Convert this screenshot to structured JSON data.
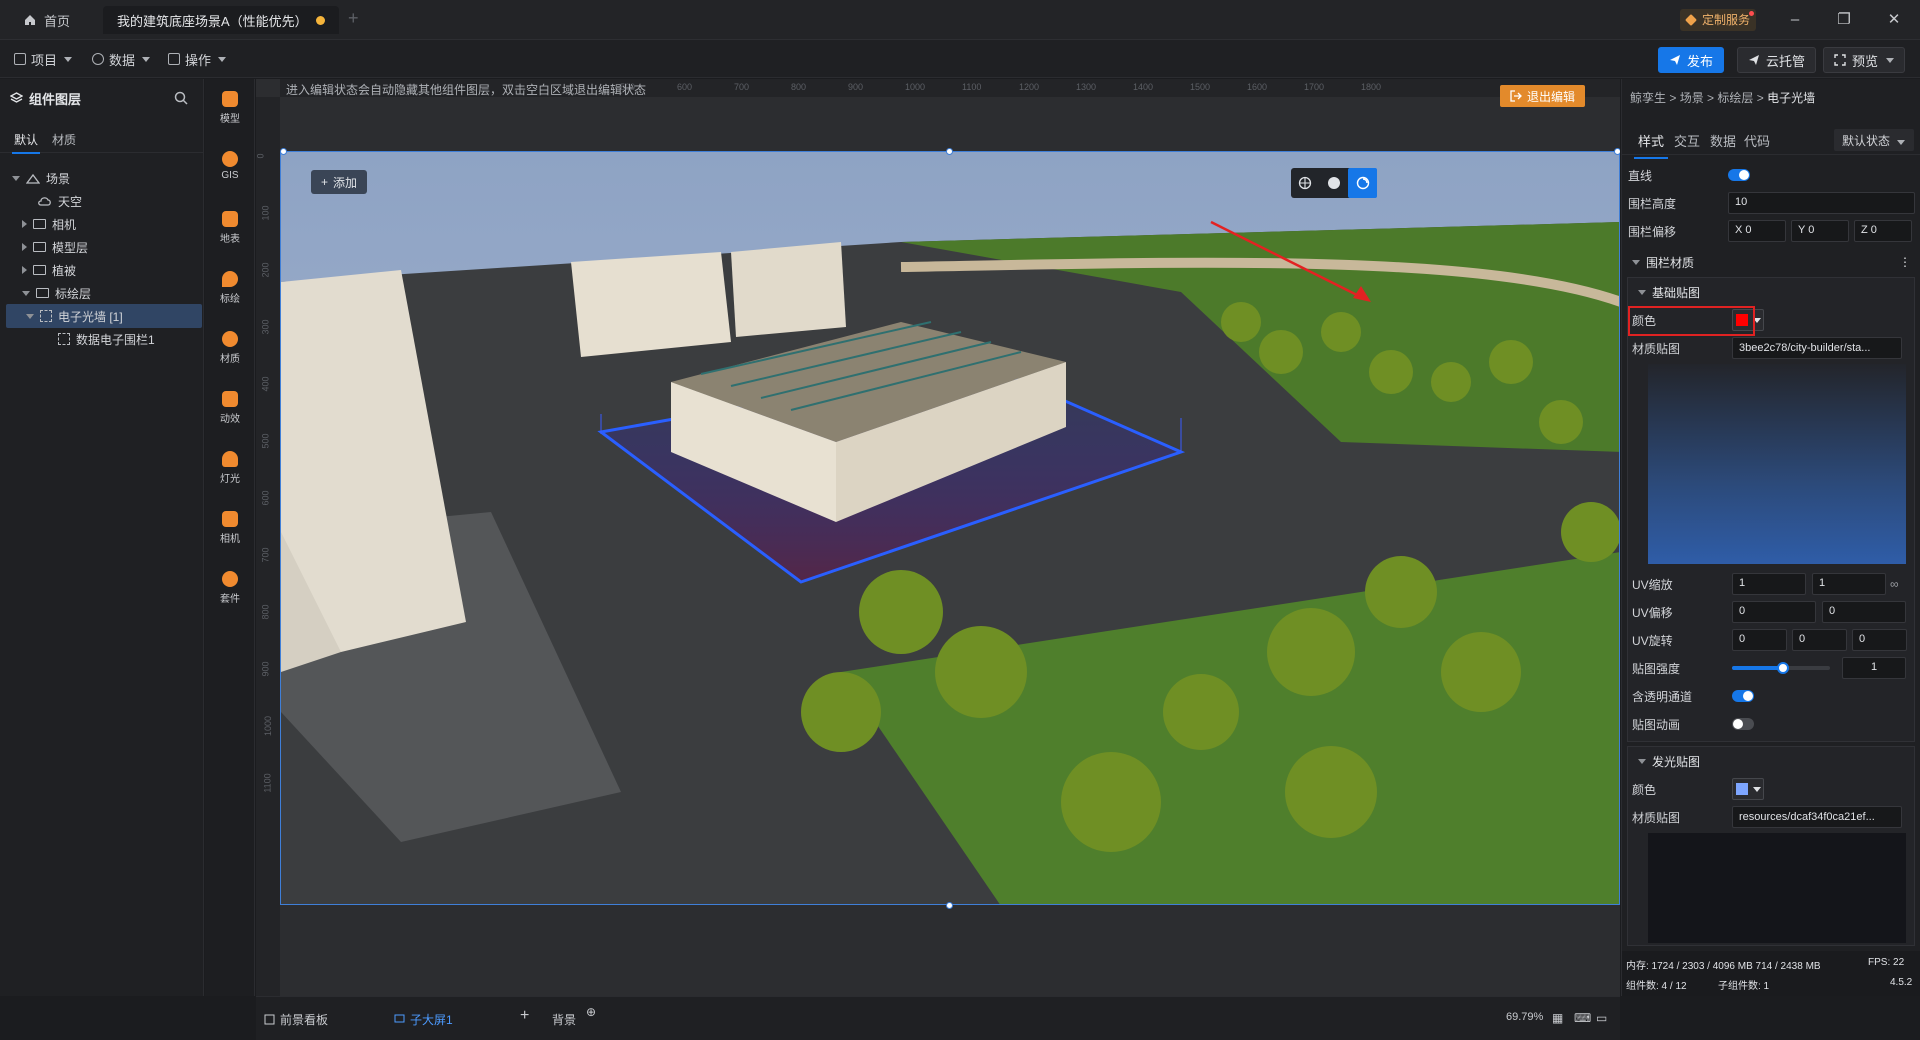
{
  "titlebar": {
    "home_tab": "首页",
    "doc_tab": "我的建筑底座场景A（性能优先）",
    "custom_service": "定制服务"
  },
  "toolbar": {
    "menus": [
      "项目",
      "数据",
      "操作"
    ],
    "publish": "发布",
    "cloud": "云托管",
    "preview": "预览"
  },
  "layers": {
    "title": "组件图层",
    "tabs": [
      "默认",
      "材质"
    ],
    "tree": [
      {
        "label": "场景"
      },
      {
        "label": "天空"
      },
      {
        "label": "相机"
      },
      {
        "label": "模型层"
      },
      {
        "label": "植被"
      },
      {
        "label": "标绘层"
      },
      {
        "label": "电子光墙 [1]"
      },
      {
        "label": "数据电子围栏1"
      }
    ]
  },
  "rail": [
    "模型",
    "GIS",
    "地表",
    "标绘",
    "材质",
    "动效",
    "灯光",
    "相机",
    "套件"
  ],
  "canvas": {
    "hint": "进入编辑状态会自动隐藏其他组件图层，双击空白区域退出编辑状态",
    "exit_edit": "退出编辑",
    "add": "添加",
    "ruler_top": [
      "500",
      "600",
      "700",
      "800",
      "900",
      "1000",
      "1100",
      "1200",
      "1300",
      "1400",
      "1500",
      "1600",
      "1700",
      "1800"
    ],
    "ruler_left": [
      "0",
      "100",
      "200",
      "300",
      "400",
      "500",
      "600",
      "700",
      "800",
      "900",
      "1000",
      "1100"
    ]
  },
  "bottombar": {
    "tabs": [
      "前景看板",
      "子大屏1",
      "背景"
    ],
    "zoom": "69.79%"
  },
  "props": {
    "breadcrumb": [
      "鲸孪生",
      "场景",
      "标绘层",
      "电子光墙"
    ],
    "tabs": [
      "样式",
      "交互",
      "数据",
      "代码"
    ],
    "state": "默认状态",
    "straight_label": "直线",
    "fence_height_label": "围栏高度",
    "fence_height": "10",
    "fence_offset_label": "围栏偏移",
    "offset": {
      "x": "0",
      "y": "0",
      "z": "0"
    },
    "material_section": "围栏材质",
    "base_map": {
      "title": "基础贴图",
      "color_label": "颜色",
      "color": "#ff0000",
      "texture_label": "材质贴图",
      "texture": "3bee2c78/city-builder/sta...",
      "uv_scale_label": "UV缩放",
      "uv_scale": [
        "1",
        "1"
      ],
      "uv_offset_label": "UV偏移",
      "uv_offset": [
        "0",
        "0"
      ],
      "uv_rotate_label": "UV旋转",
      "uv_rotate": [
        "0",
        "0",
        "0"
      ],
      "intensity_label": "贴图强度",
      "intensity": "1",
      "alpha_label": "含透明通道",
      "anim_label": "贴图动画"
    },
    "emissive_map": {
      "title": "发光贴图",
      "color_label": "颜色",
      "color": "#7ea6ff",
      "texture_label": "材质贴图",
      "texture": "resources/dcaf34f0ca21ef..."
    },
    "status": {
      "memory": "内存:  1724 / 2303 / 4096 MB  714 / 2438 MB",
      "fps": "FPS:  22",
      "components": "组件数: 4 / 12",
      "children": "子组件数: 1",
      "version": "4.5.2"
    }
  },
  "colors": {
    "accent": "#1677e8",
    "exit": "#e38a2b"
  }
}
